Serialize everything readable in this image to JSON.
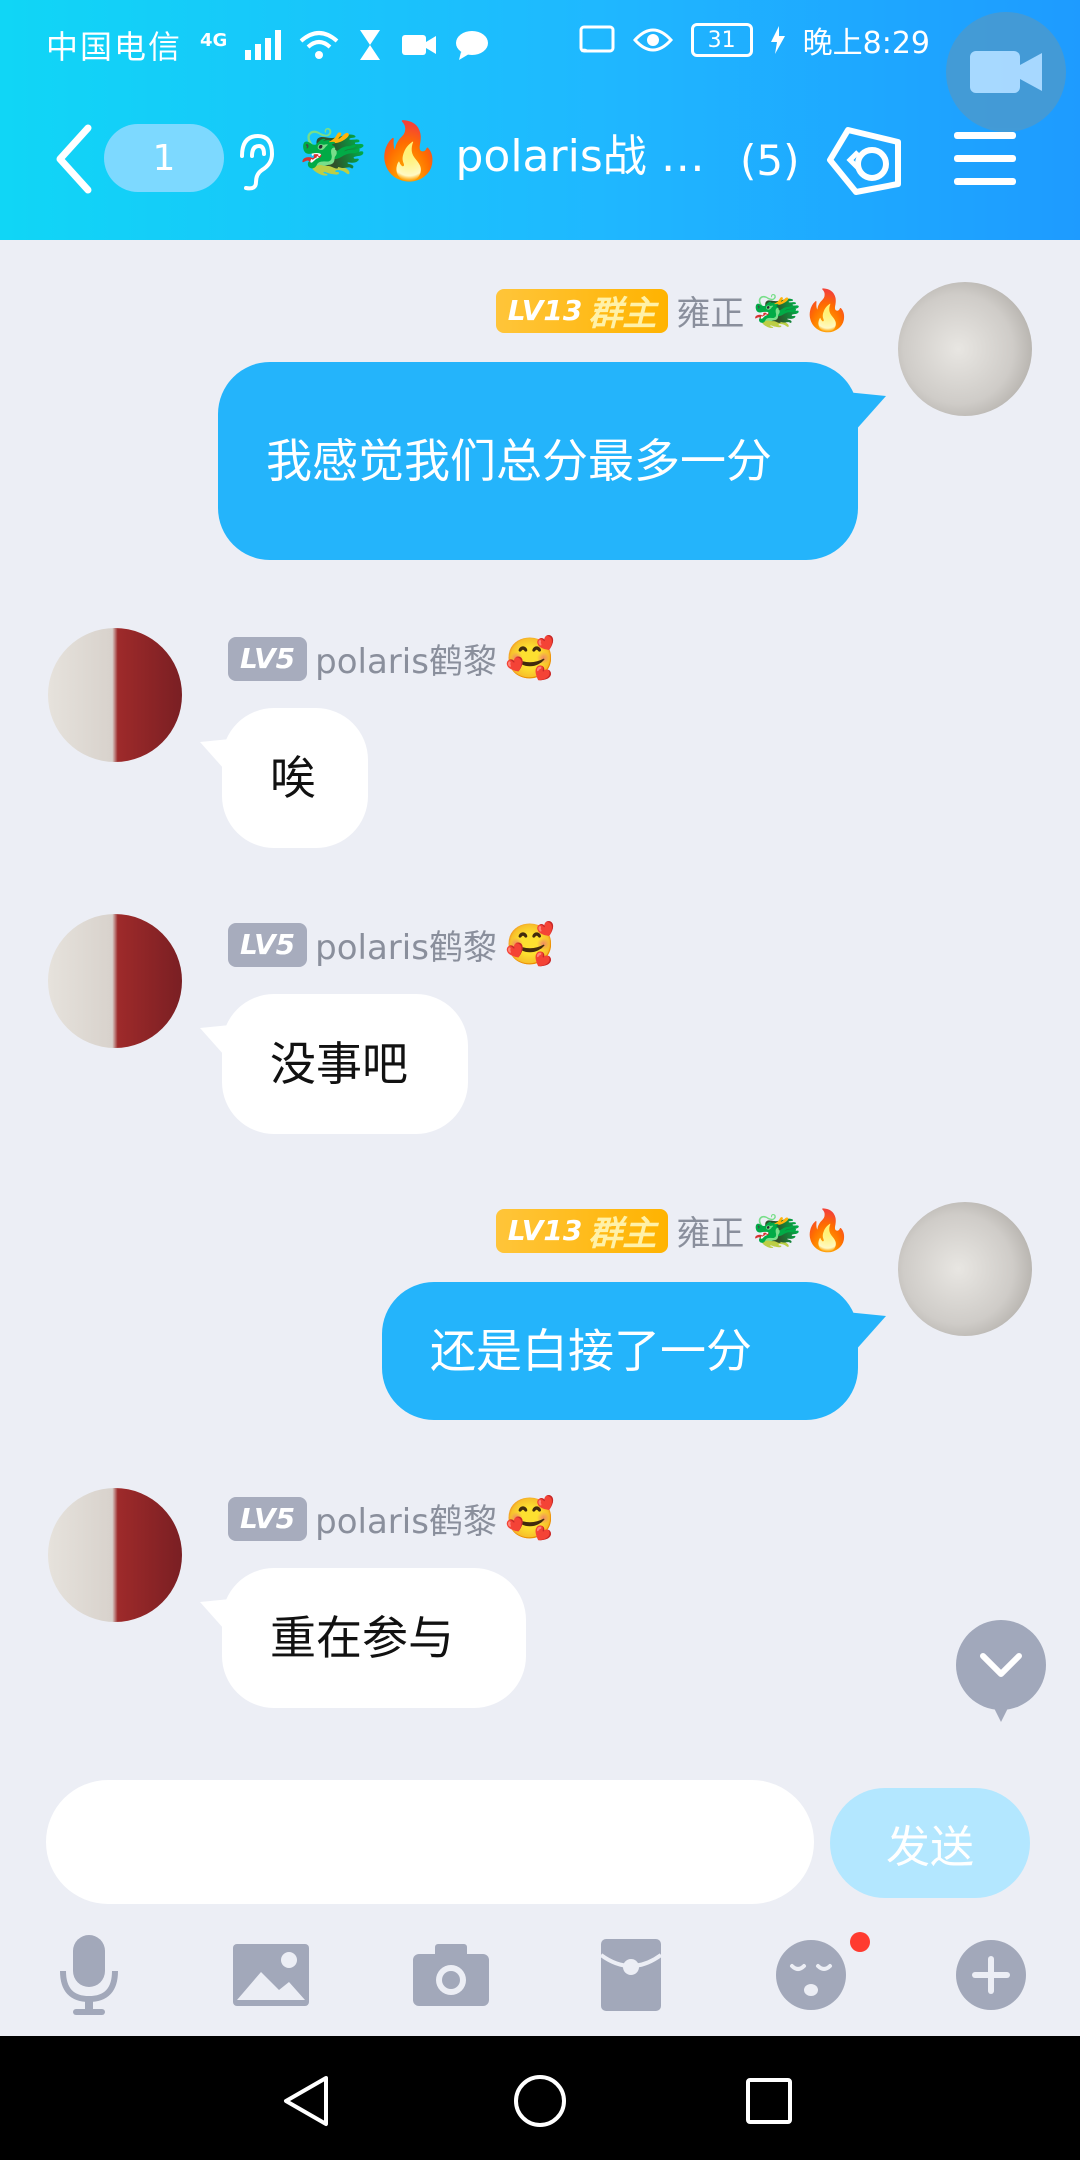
{
  "status_bar": {
    "carrier": "中国电信",
    "network": "4G",
    "battery": "31",
    "time": "晚上8:29"
  },
  "nav": {
    "unread_count": "1",
    "emojis": [
      "🐲",
      "🔥"
    ],
    "title": "polaris战 …",
    "member_count": "(5)"
  },
  "messages": [
    {
      "side": "out",
      "level": "LV13",
      "role": "群主",
      "nickname": "雍正",
      "nick_emojis": "🐲🔥",
      "text": "我感觉我们总分最多一分"
    },
    {
      "side": "in",
      "level": "LV5",
      "nickname": "polaris鹤黎",
      "nick_emojis": "🥰",
      "text": "唉"
    },
    {
      "side": "in",
      "level": "LV5",
      "nickname": "polaris鹤黎",
      "nick_emojis": "🥰",
      "text": "没事吧"
    },
    {
      "side": "out",
      "level": "LV13",
      "role": "群主",
      "nickname": "雍正",
      "nick_emojis": "🐲🔥",
      "text": "还是白接了一分"
    },
    {
      "side": "in",
      "level": "LV5",
      "nickname": "polaris鹤黎",
      "nick_emojis": "🥰",
      "text": "重在参与"
    }
  ],
  "composer": {
    "input_value": "",
    "send_label": "发送"
  },
  "toolbar": {
    "icons": [
      "microphone-icon",
      "image-icon",
      "camera-icon",
      "red-packet-icon",
      "emoji-icon",
      "plus-icon"
    ],
    "emoji_has_notification": true
  },
  "colors": {
    "header_start": "#10d6f6",
    "header_end": "#1e9bff",
    "bubble_out": "#24b4fb",
    "background": "#eceef5"
  }
}
